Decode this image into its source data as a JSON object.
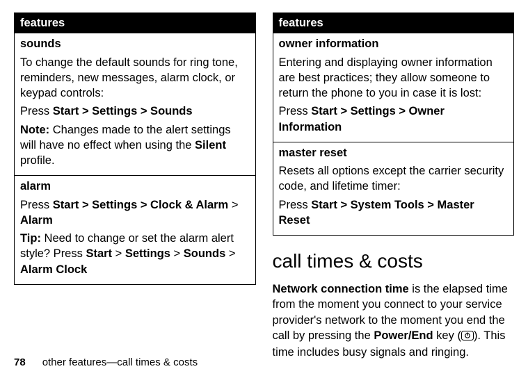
{
  "left": {
    "header": "features",
    "rows": [
      {
        "title": "sounds",
        "intro": "To change the default sounds for ring tone, reminders, new messages, alarm clock, or keypad controls:",
        "press_label": "Press ",
        "path_prefix": "Start",
        "path_rest": " > Settings > Sounds",
        "note_label": "Note:",
        "note_text_a": " Changes made to the alert settings will have no effect when using the ",
        "silent": "Silent",
        "note_text_b": " profile."
      },
      {
        "title": "alarm",
        "press_label": "Press ",
        "path_prefix": "Start",
        "path_mid_a": " > Settings > Clock & Alarm",
        "path_sep": " > ",
        "path_last": "Alarm",
        "tip_label": "Tip:",
        "tip_text": " Need to change or set the alarm alert style? Press ",
        "tip_path_a": "Start",
        "tip_sep1": " > ",
        "tip_path_b": "Settings",
        "tip_sep2": " > ",
        "tip_path_c": "Sounds",
        "tip_sep3": " > ",
        "tip_path_d": "Alarm Clock"
      }
    ]
  },
  "right": {
    "header": "features",
    "rows": [
      {
        "title": "owner information",
        "intro": "Entering and displaying owner information are best practices; they allow someone to return the phone to you in case it is lost:",
        "press_label": "Press ",
        "path_prefix": "Start",
        "path_rest": " > Settings > Owner Information"
      },
      {
        "title": "master reset",
        "intro": "Resets all options except the carrier security code, and lifetime timer:",
        "press_label": "Press ",
        "path_prefix": "Start",
        "path_rest": " > System Tools > Master Reset"
      }
    ],
    "section_heading": "call times & costs",
    "body_bold": "Network connection time",
    "body_a": " is the elapsed time from the moment you connect to your service provider's network to the moment you end the call by pressing the ",
    "power_end": "Power/End",
    "body_b": " key (",
    "body_c": "). This time includes busy signals and ringing."
  },
  "footer": {
    "page_number": "78",
    "running_head": "other features—call times & costs"
  }
}
